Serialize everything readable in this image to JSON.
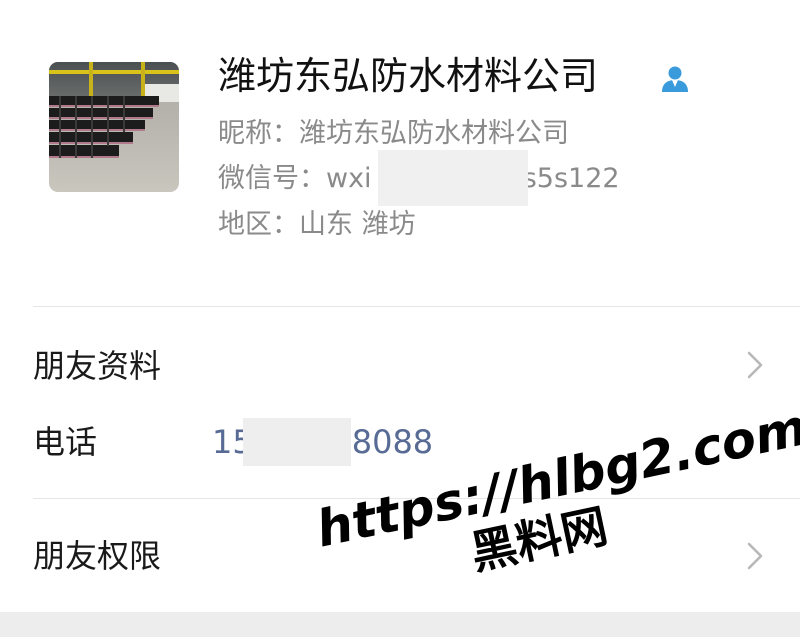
{
  "profile": {
    "name": "潍坊东弘防水材料公司",
    "nickname_line": "昵称：潍坊东弘防水材料公司",
    "wechat_id_line": "微信号：wxid",
    "wechat_id_prefix": "微信号：wxi",
    "wechat_id_suffix": "5s5s122",
    "region_line": "地区：山东  潍坊",
    "avatar": "warehouse-photo",
    "contact_icon": "person-icon"
  },
  "rows": {
    "friend_profile_label": "朋友资料",
    "phone_label": "电话",
    "phone_prefix": "15",
    "phone_suffix": "8088",
    "friend_permission_label": "朋友权限"
  },
  "watermark": {
    "url": "https://hlbg2.com",
    "name": "黑料网"
  },
  "colors": {
    "link": "#576b95",
    "secondary_text": "#8a8a8a",
    "icon_blue": "#3a9bdc",
    "divider": "#e6e6e6"
  }
}
